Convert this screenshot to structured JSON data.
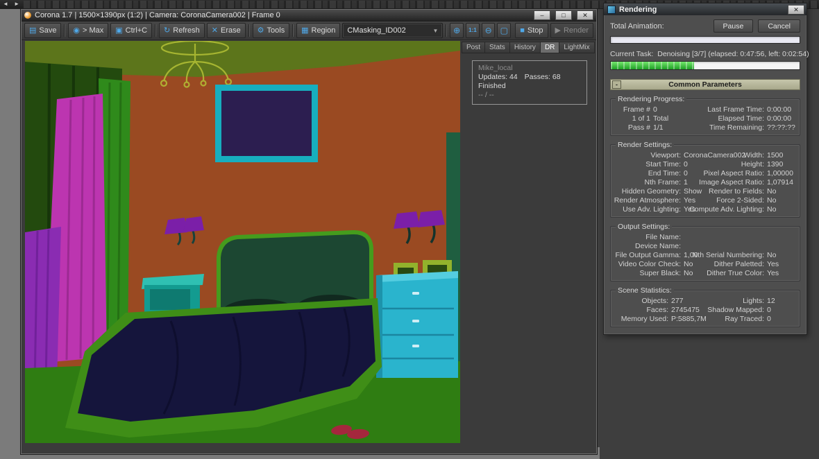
{
  "palette": {
    "toolbar_icon_blue": "#4fa8e8",
    "progress_green": "#23b32a",
    "rollout_header": "#a8a88c",
    "mask_wall": "#9a4a22",
    "mask_floor": "#2f7d12",
    "mask_bed_frame": "#3f8e17",
    "mask_blanket": "#15153c",
    "mask_dresser": "#2ab4cd",
    "mask_curtain_magenta": "#bc35b0",
    "mask_curtain_green": "#2f8a1b",
    "mask_drape_purple": "#8a2cb2",
    "mask_picture_frame_teal": "#17aebe"
  },
  "icons": {
    "save": "▤",
    "max": "◉",
    "copy": "▣",
    "refresh": "↻",
    "erase": "✕",
    "tools": "⚙",
    "region": "▦",
    "zoom_in": "⊕",
    "zoom_actual": "1:1",
    "zoom_out": "⊖",
    "zoom_fit": "▢",
    "stop": "■",
    "render": "▶",
    "dropdown_arrow": "▼",
    "minimize": "–",
    "maximize": "□",
    "close": "✕",
    "collapse": "-"
  },
  "corona_window": {
    "title": "Corona 1.7 | 1500×1390px (1:2) | Camera: CoronaCamera002 | Frame 0",
    "toolbar": {
      "save": "Save",
      "max": "> Max",
      "copy": "Ctrl+C",
      "refresh": "Refresh",
      "erase": "Erase",
      "tools": "Tools",
      "region": "Region",
      "mask_selector": "CMasking_ID002",
      "stop": "Stop",
      "render": "Render"
    },
    "tabs": [
      {
        "label": "Post",
        "active": false
      },
      {
        "label": "Stats",
        "active": false
      },
      {
        "label": "History",
        "active": false
      },
      {
        "label": "DR",
        "active": true
      },
      {
        "label": "LightMix",
        "active": false
      }
    ],
    "dr_stats": {
      "node_name": "Mike_local",
      "updates": "Updates: 44",
      "passes": "Passes: 68",
      "status": "Finished",
      "progress": "-- / --"
    }
  },
  "render_dialog": {
    "title": "Rendering",
    "total_animation_label": "Total Animation:",
    "pause_button": "Pause",
    "cancel_button": "Cancel",
    "total_progress_percent": 0,
    "current_task_label": "Current Task:",
    "current_task_value": "Denoising [3/7] (elapsed: 0:47:56, left: 0:02:54)",
    "task_progress_percent": 44,
    "rollout_title": "Common Parameters",
    "progress_group": {
      "title": "Rendering Progress:",
      "rows": [
        {
          "l1": "Frame #",
          "l2": "0",
          "r1": "Last Frame Time:",
          "r2": "0:00:00"
        },
        {
          "l1": "1 of 1",
          "l2": "Total",
          "r1": "Elapsed Time:",
          "r2": "0:00:00"
        },
        {
          "l1": "Pass #",
          "l2": "1/1",
          "r1": "Time Remaining:",
          "r2": "??:??:??"
        }
      ]
    },
    "settings_group": {
      "title": "Render Settings:",
      "rows": [
        {
          "l1": "Viewport:",
          "l2": "CoronaCamera002",
          "r1": "Width:",
          "r2": "1500"
        },
        {
          "l1": "Start Time:",
          "l2": "0",
          "r1": "Height:",
          "r2": "1390"
        },
        {
          "l1": "End Time:",
          "l2": "0",
          "r1": "Pixel Aspect Ratio:",
          "r2": "1,00000"
        },
        {
          "l1": "Nth Frame:",
          "l2": "1",
          "r1": "Image Aspect Ratio:",
          "r2": "1,07914"
        },
        {
          "l1": "Hidden Geometry:",
          "l2": "Show",
          "r1": "Render to Fields:",
          "r2": "No"
        },
        {
          "l1": "Render Atmosphere:",
          "l2": "Yes",
          "r1": "Force 2-Sided:",
          "r2": "No"
        },
        {
          "l1": "Use Adv. Lighting:",
          "l2": "Yes",
          "r1": "Compute Adv. Lighting:",
          "r2": "No"
        }
      ]
    },
    "output_group": {
      "title": "Output Settings:",
      "rows": [
        {
          "l1": "File Name:",
          "l2": "",
          "r1": "",
          "r2": ""
        },
        {
          "l1": "Device Name:",
          "l2": "",
          "r1": "",
          "r2": ""
        },
        {
          "l1": "File Output Gamma:",
          "l2": "1,00",
          "r1": "Nth Serial Numbering:",
          "r2": "No"
        },
        {
          "l1": "Video Color Check:",
          "l2": "No",
          "r1": "Dither Paletted:",
          "r2": "Yes"
        },
        {
          "l1": "Super Black:",
          "l2": "No",
          "r1": "Dither True Color:",
          "r2": "Yes"
        }
      ]
    },
    "stats_group": {
      "title": "Scene Statistics:",
      "rows": [
        {
          "l1": "Objects:",
          "l2": "277",
          "r1": "Lights:",
          "r2": "12"
        },
        {
          "l1": "Faces:",
          "l2": "2745475",
          "r1": "Shadow Mapped:",
          "r2": "0"
        },
        {
          "l1": "Memory Used:",
          "l2": "P:5885,7M",
          "r1": "Ray Traced:",
          "r2": "0"
        }
      ]
    }
  }
}
